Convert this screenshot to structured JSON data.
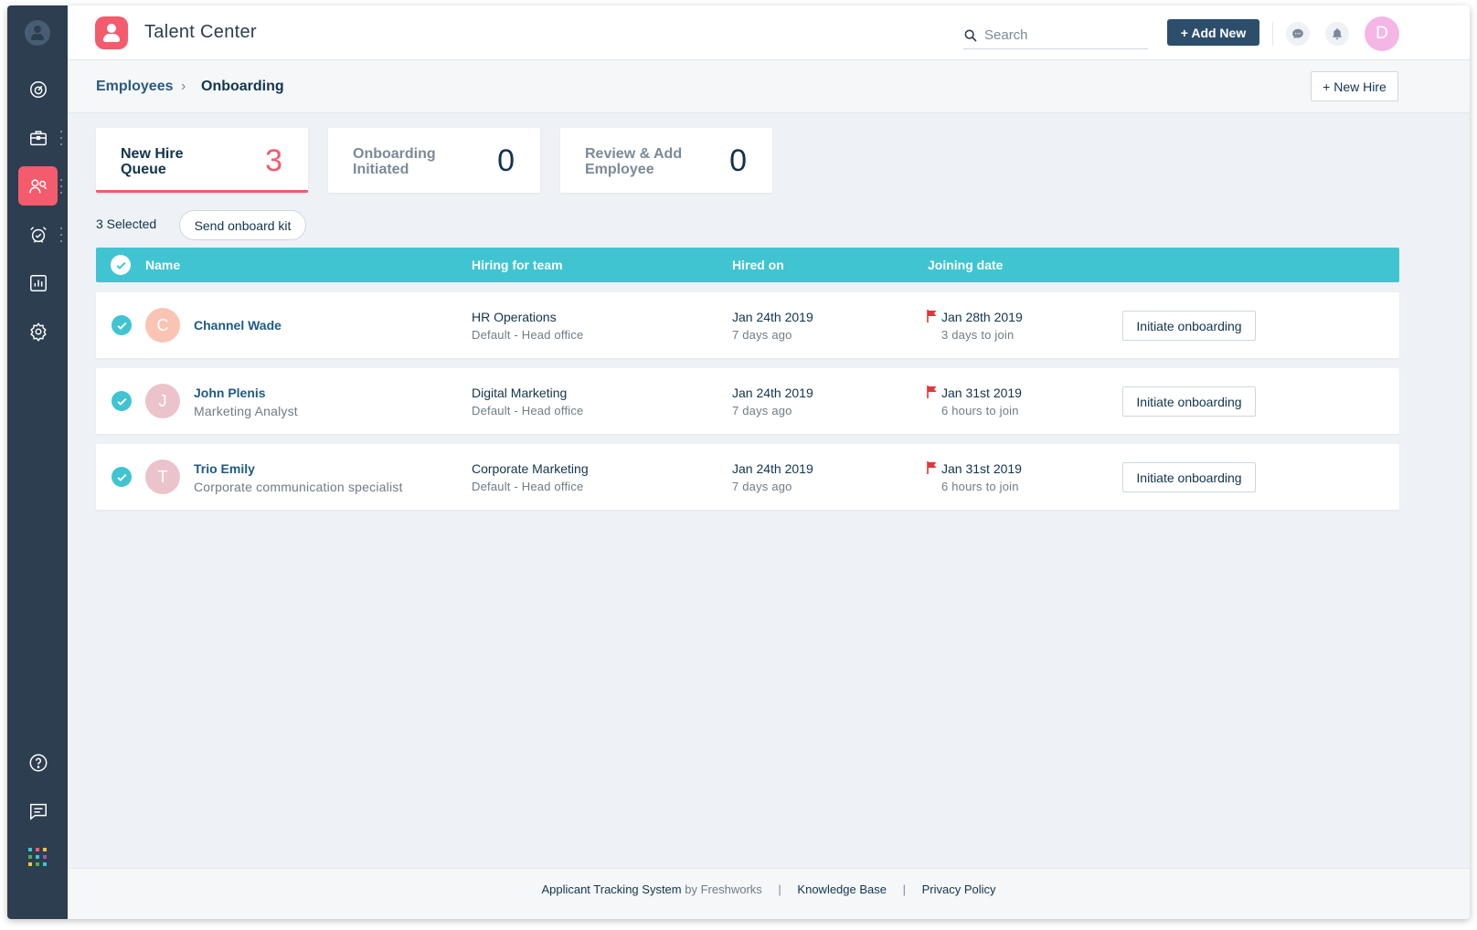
{
  "app": {
    "title": "Talent Center"
  },
  "header": {
    "search_placeholder": "Search",
    "add_new_label": "+ Add New",
    "avatar_initial": "D"
  },
  "sidebar": {
    "items": [
      {
        "name": "dashboard-icon",
        "active": false
      },
      {
        "name": "jobs-briefcase-icon",
        "active": false
      },
      {
        "name": "employees-people-icon",
        "active": true
      },
      {
        "name": "timeoff-alarm-icon",
        "active": false
      },
      {
        "name": "reports-chart-icon",
        "active": false
      },
      {
        "name": "settings-gear-icon",
        "active": false
      }
    ],
    "bottom": [
      "help-icon",
      "chat-icon",
      "apps-grid-icon"
    ],
    "accent": "#f45b6d",
    "background": "#2c3e50"
  },
  "breadcrumb": {
    "parent": "Employees",
    "current": "Onboarding"
  },
  "new_hire_label": "+ New Hire",
  "stats": [
    {
      "label": "New Hire Queue",
      "count": "3",
      "active": true
    },
    {
      "label": "Onboarding Initiated",
      "count": "0",
      "active": false
    },
    {
      "label": "Review & Add Employee",
      "count": "0",
      "active": false
    }
  ],
  "selection": {
    "count_text": "3 Selected",
    "action_label": "Send onboard kit"
  },
  "table": {
    "header_color": "#40c4d1",
    "columns": {
      "name": "Name",
      "team": "Hiring for team",
      "hired": "Hired on",
      "joining": "Joining date"
    },
    "rows": [
      {
        "initial": "C",
        "avatar_color": "#f9c4b4",
        "name": "Channel Wade",
        "role": "",
        "team": "HR Operations",
        "office": "Default - Head office",
        "hired_on": "Jan 24th 2019",
        "hired_ago": "7 days ago",
        "joining": "Jan 28th 2019",
        "joining_in": "3 days to join",
        "action": "Initiate onboarding"
      },
      {
        "initial": "J",
        "avatar_color": "#ebc3cb",
        "name": "John Plenis",
        "role": "Marketing Analyst",
        "team": "Digital Marketing",
        "office": "Default - Head office",
        "hired_on": "Jan 24th 2019",
        "hired_ago": "7 days ago",
        "joining": "Jan 31st 2019",
        "joining_in": "6 hours to join",
        "action": "Initiate onboarding"
      },
      {
        "initial": "T",
        "avatar_color": "#ebc3cb",
        "name": "Trio Emily",
        "role": "Corporate communication specialist",
        "team": "Corporate Marketing",
        "office": "Default - Head office",
        "hired_on": "Jan 24th 2019",
        "hired_ago": "7 days ago",
        "joining": "Jan 31st 2019",
        "joining_in": "6 hours to join",
        "action": "Initiate onboarding"
      }
    ]
  },
  "footer": {
    "product": "Applicant Tracking System",
    "by": "by Freshworks",
    "sep": "|",
    "knowledge_base": "Knowledge Base",
    "privacy": "Privacy Policy"
  }
}
